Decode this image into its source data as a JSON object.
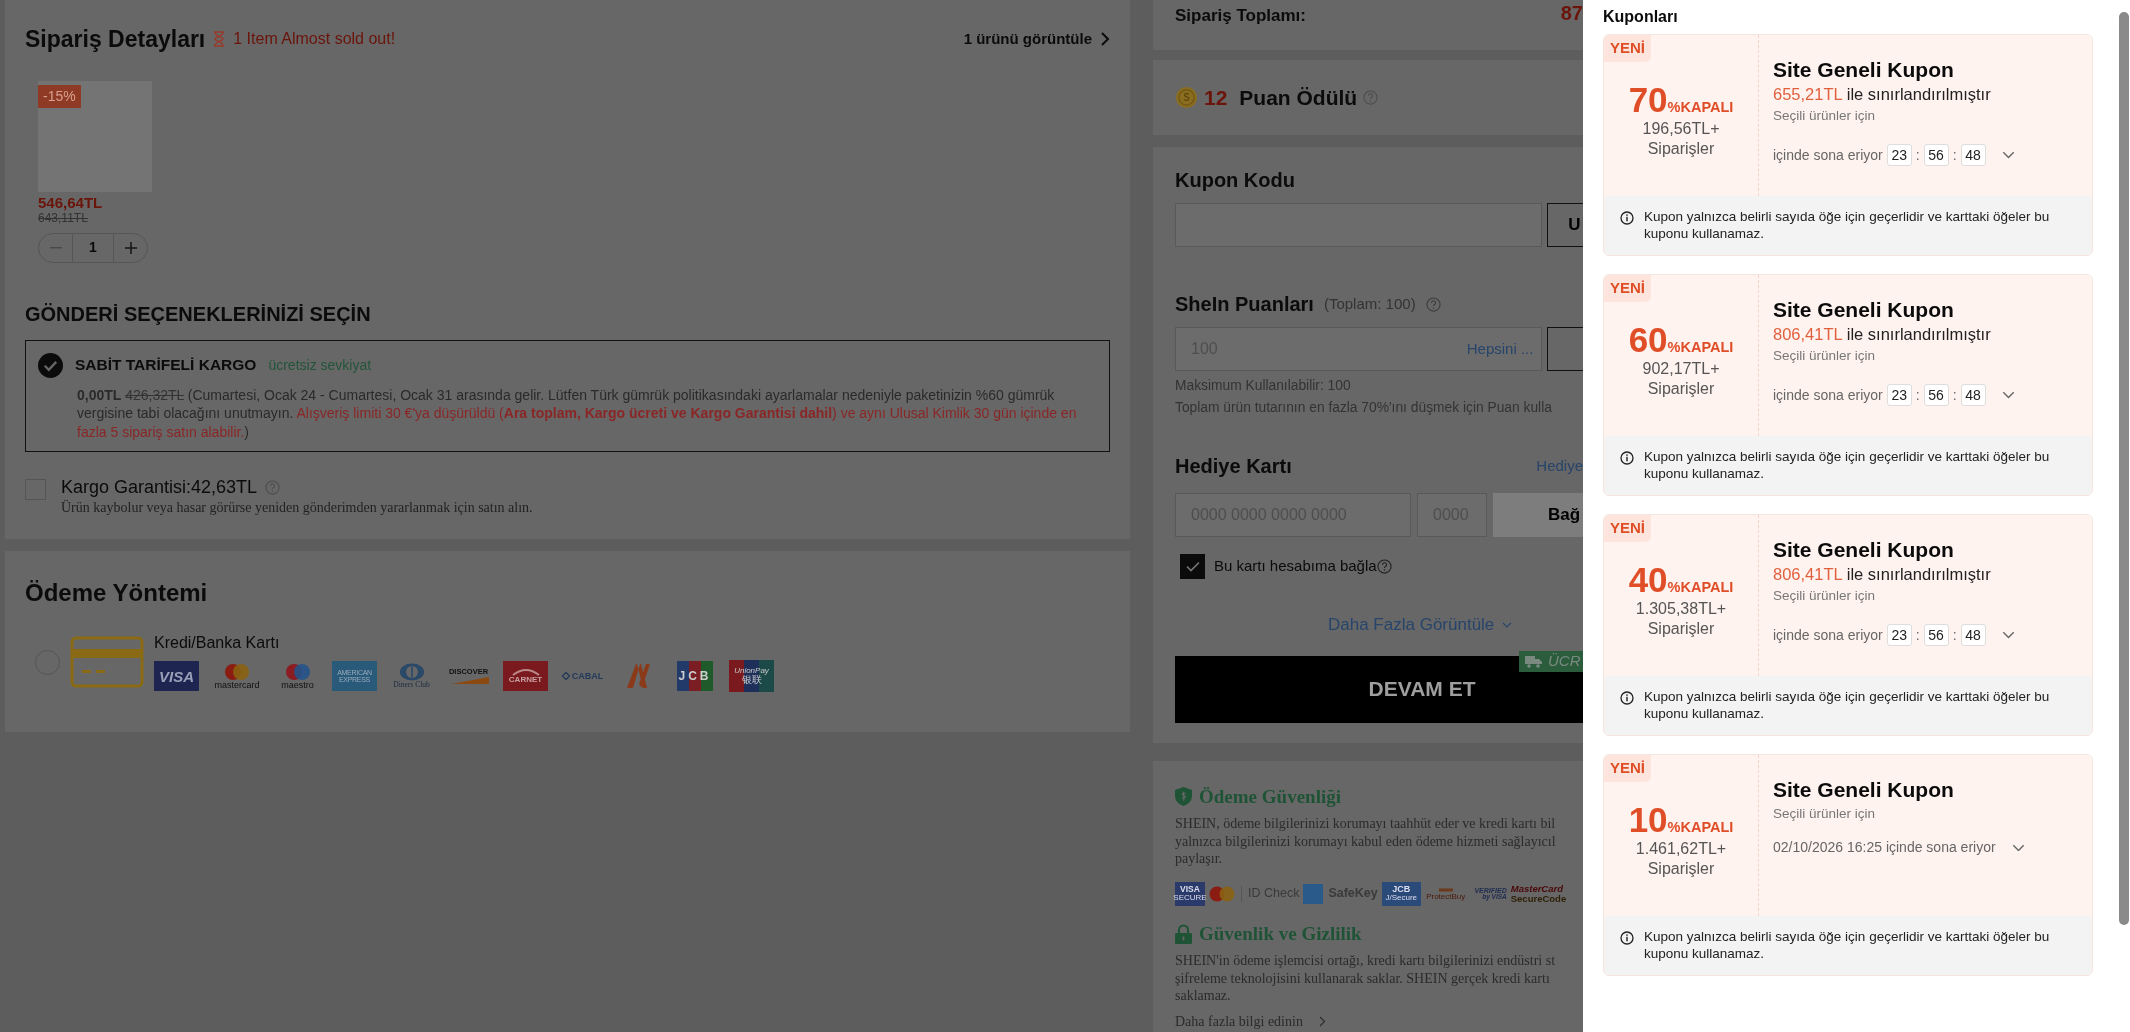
{
  "order_details": {
    "title": "Sipariş Detayları",
    "alert": "1 Item Almost sold out!",
    "view_link": "1 ürünü görüntüle",
    "product": {
      "discount": "-15%",
      "price": "546,64TL",
      "old_price": "643,11TL",
      "quantity": "1"
    }
  },
  "shipping": {
    "title": "GÖNDERİ SEÇENEKLERİNİZİ SEÇİN",
    "options": [
      {
        "name": "SABİT TARİFELİ KARGO",
        "tag": "ücretsiz sevkiyat",
        "selected": true,
        "price": "0,00TL",
        "old_price": "426,32TL",
        "note": "(Cumartesi, Ocak 24 - Cumartesi, Ocak 31 arasında gelir. Lütfen Türk gümrük politikasındaki ayarlamalar nedeniyle paketinizin %60 gümrük vergisine tabi olacağını unutmayın.",
        "warning": "Alışveriş limiti 30 €'ya düşürüldü (**Ara toplam, Kargo ücreti ve Kargo Garantisi dahil**) ve aynı Ulusal Kimlik 30 gün içinde en fazla 5 sipariş satın alabilir.",
        "note_end": ")"
      }
    ]
  },
  "insurance": {
    "label": "Kargo Garantisi:42,63TL",
    "checked": false,
    "description": "Ürün kaybolur veya hasar görürse yeniden gönderimden yararlanmak için satın alın."
  },
  "payment": {
    "title": "Ödeme Yöntemi",
    "methods": [
      {
        "label": "Kredi/Banka Kartı",
        "selected": false,
        "logos": [
          {
            "kind": "visa",
            "texts": [
              "VISA"
            ]
          },
          {
            "kind": "mastercard",
            "texts": [
              "mastercard"
            ]
          },
          {
            "kind": "maestro",
            "texts": [
              "maestro"
            ]
          },
          {
            "kind": "amex",
            "texts": [
              "AMERICAN",
              "EXPRESS"
            ]
          },
          {
            "kind": "diners",
            "texts": [
              "Diners Club"
            ]
          },
          {
            "kind": "discover",
            "texts": [
              "DISCOVER"
            ]
          },
          {
            "kind": "carnet",
            "texts": [
              "CARNET"
            ]
          },
          {
            "kind": "cabal",
            "texts": [
              "CABAL"
            ]
          },
          {
            "kind": "n"
          },
          {
            "kind": "jcb",
            "texts": [
              "JCB"
            ]
          },
          {
            "kind": "unionpay",
            "texts": [
              "UnionPay",
              "银联"
            ]
          }
        ]
      }
    ]
  },
  "summary": {
    "label": "Sipariş Toplamı:",
    "amount": "87"
  },
  "points_reward": {
    "amount": "12",
    "label": "Puan Ödülü"
  },
  "coupon_code": {
    "title": "Kupon Kodu",
    "button": "U"
  },
  "points": {
    "title": "SheIn Puanları",
    "total": "(Toplam: 100)",
    "placeholder": "100",
    "all_link": "Hepsini ...",
    "max": "Maksimum Kullanılabilir: 100",
    "hint": "Toplam ürün tutarının en fazla 70%'ını düşmek için Puan kulla"
  },
  "gift_card": {
    "title": "Hediye Kartı",
    "link": "Hediye",
    "number_placeholder": "0000 0000 0000 0000",
    "pin_placeholder": "0000",
    "button": "Bağ",
    "bind": {
      "label": "Bu kartı hesabıma bağla",
      "checked": true
    }
  },
  "more_link": "Daha Fazla Görüntüle",
  "checkout": {
    "button": "DEVAM ET",
    "banner": "ÜCR"
  },
  "security": {
    "sections": [
      {
        "kind": "shield",
        "title": "Ödeme Güvenliği",
        "lines": [
          "SHEIN, ödeme bilgilerinizi korumayı taahhüt eder ve kredi kartı bil",
          "yalnızca bilgilerinizi korumayı kabul eden ödeme hizmeti sağlayıcıl",
          "paylaşır."
        ],
        "logos": [
          {
            "kind": "visa_secure",
            "texts": [
              "VISA",
              "SECURE"
            ]
          },
          {
            "kind": "id_check",
            "texts": [
              "ID Check"
            ]
          },
          {
            "kind": "safekey",
            "texts": [
              "SafeKey"
            ]
          },
          {
            "kind": "jcb_secure",
            "texts": [
              "JCB",
              "J/Secure"
            ]
          },
          {
            "kind": "protectbuy",
            "texts": [
              "ProtectBuy"
            ]
          },
          {
            "kind": "verified",
            "texts": [
              "VERIFIED",
              "by VISA"
            ]
          },
          {
            "kind": "securecode",
            "texts": [
              "MasterCard",
              "SecureCode"
            ]
          }
        ]
      },
      {
        "kind": "lock",
        "title": "Güvenlik ve Gizlilik",
        "lines": [
          "SHEIN'in ödeme işlemcisi ortağı, kredi kartı bilgilerinizi endüstri st",
          "şifreleme teknolojisini kullanarak saklar. SHEIN gerçek kredi kartı",
          "saklamaz."
        ]
      }
    ],
    "learn_more": "Daha fazla bilgi edinin"
  },
  "coupons_panel": {
    "title": "Kuponları",
    "coupons": [
      {
        "badge": "YENİ",
        "discount": "70",
        "unit": "%KAPALI",
        "min_order": "196,56TL+",
        "min_label": "Siparişler",
        "title": "Site Geneli Kupon",
        "limit_amount": "655,21TL",
        "limit_text": "ile sınırlandırılmıştır",
        "scope": "Seçili ürünler için",
        "expiry": {
          "kind": "countdown",
          "label": "içinde sona eriyor",
          "parts": [
            {
              "kind": "digit",
              "text": "23"
            },
            {
              "kind": "sep",
              "text": ":"
            },
            {
              "kind": "digit",
              "text": "56"
            },
            {
              "kind": "sep",
              "text": ":"
            },
            {
              "kind": "digit",
              "text": "48"
            }
          ]
        },
        "note": "Kupon yalnızca belirli sayıda öğe için geçerlidir ve karttaki öğeler bu kuponu kullanamaz."
      },
      {
        "badge": "YENİ",
        "discount": "60",
        "unit": "%KAPALI",
        "min_order": "902,17TL+",
        "min_label": "Siparişler",
        "title": "Site Geneli Kupon",
        "limit_amount": "806,41TL",
        "limit_text": "ile sınırlandırılmıştır",
        "scope": "Seçili ürünler için",
        "expiry": {
          "kind": "countdown",
          "label": "içinde sona eriyor",
          "parts": [
            {
              "kind": "digit",
              "text": "23"
            },
            {
              "kind": "sep",
              "text": ":"
            },
            {
              "kind": "digit",
              "text": "56"
            },
            {
              "kind": "sep",
              "text": ":"
            },
            {
              "kind": "digit",
              "text": "48"
            }
          ]
        },
        "note": "Kupon yalnızca belirli sayıda öğe için geçerlidir ve karttaki öğeler bu kuponu kullanamaz."
      },
      {
        "badge": "YENİ",
        "discount": "40",
        "unit": "%KAPALI",
        "min_order": "1.305,38TL+",
        "min_label": "Siparişler",
        "title": "Site Geneli Kupon",
        "limit_amount": "806,41TL",
        "limit_text": "ile sınırlandırılmıştır",
        "scope": "Seçili ürünler için",
        "expiry": {
          "kind": "countdown",
          "label": "içinde sona eriyor",
          "parts": [
            {
              "kind": "digit",
              "text": "23"
            },
            {
              "kind": "sep",
              "text": ":"
            },
            {
              "kind": "digit",
              "text": "56"
            },
            {
              "kind": "sep",
              "text": ":"
            },
            {
              "kind": "digit",
              "text": "48"
            }
          ]
        },
        "note": "Kupon yalnızca belirli sayıda öğe için geçerlidir ve karttaki öğeler bu kuponu kullanamaz."
      },
      {
        "badge": "YENİ",
        "discount": "10",
        "unit": "%KAPALI",
        "min_order": "1.461,62TL+",
        "min_label": "Siparişler",
        "title": "Site Geneli Kupon",
        "scope": "Seçili ürünler için",
        "expiry": {
          "kind": "date",
          "label": "02/10/2026 16:25 içinde sona eriyor"
        },
        "note": "Kupon yalnızca belirli sayıda öğe için geçerlidir ve karttaki öğeler bu kuponu kullanamaz."
      }
    ]
  }
}
